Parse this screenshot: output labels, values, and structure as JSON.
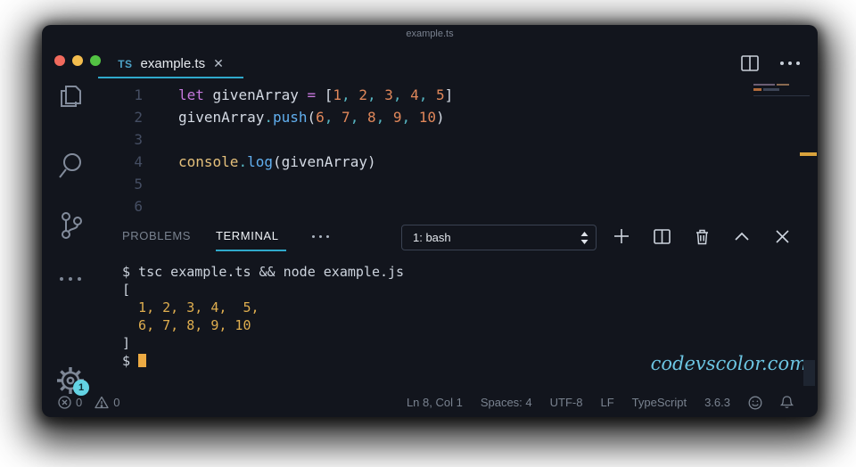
{
  "window": {
    "title": "example.ts"
  },
  "colors": {
    "accent_cyan": "#2fa9cb",
    "badge_cyan": "#63d3e4",
    "ruler_mark_orange": "#d9a33c",
    "terminal_yellow": "#dfae4f",
    "keyword_purple": "#c678dd",
    "number_orange": "#e0875a",
    "function_blue": "#61afef",
    "object_yellow": "#e5c07b"
  },
  "activity_bar": {
    "settings_badge": "1"
  },
  "tab_bar": {
    "tab_icon": "TS",
    "tab_label": "example.ts",
    "close_glyph": "✕"
  },
  "editor": {
    "lines": [
      {
        "num": "1",
        "tokens": [
          [
            "kw",
            "let"
          ],
          [
            "fg",
            " givenArray "
          ],
          [
            "kw",
            "="
          ],
          [
            "fg",
            " ["
          ],
          [
            "num",
            "1"
          ],
          [
            "comma",
            ", "
          ],
          [
            "num",
            "2"
          ],
          [
            "comma",
            ", "
          ],
          [
            "num",
            "3"
          ],
          [
            "comma",
            ", "
          ],
          [
            "num",
            "4"
          ],
          [
            "comma",
            ", "
          ],
          [
            "num",
            "5"
          ],
          [
            "fg",
            "]"
          ]
        ]
      },
      {
        "num": "2",
        "tokens": [
          [
            "fg",
            "givenArray"
          ],
          [
            "dot",
            "."
          ],
          [
            "fn",
            "push"
          ],
          [
            "fg",
            "("
          ],
          [
            "num",
            "6"
          ],
          [
            "comma",
            ", "
          ],
          [
            "num",
            "7"
          ],
          [
            "comma",
            ", "
          ],
          [
            "num",
            "8"
          ],
          [
            "comma",
            ", "
          ],
          [
            "num",
            "9"
          ],
          [
            "comma",
            ", "
          ],
          [
            "num",
            "10"
          ],
          [
            "fg",
            ")"
          ]
        ]
      },
      {
        "num": "3",
        "tokens": []
      },
      {
        "num": "4",
        "tokens": [
          [
            "obj",
            "console"
          ],
          [
            "dot",
            "."
          ],
          [
            "fn",
            "log"
          ],
          [
            "fg",
            "("
          ],
          [
            "fg",
            "givenArray"
          ],
          [
            "fg",
            ")"
          ]
        ]
      },
      {
        "num": "5",
        "tokens": []
      },
      {
        "num": "6",
        "tokens": []
      }
    ]
  },
  "panel": {
    "tab_problems": "PROBLEMS",
    "tab_terminal": "TERMINAL",
    "dropdown_value": "1: bash"
  },
  "terminal": {
    "lines": [
      {
        "cls": "fg",
        "text": "$ tsc example.ts && node example.js"
      },
      {
        "cls": "fg",
        "text": "["
      },
      {
        "cls": "yellow",
        "text": "  1, 2, 3, 4,  5,"
      },
      {
        "cls": "yellow",
        "text": "  6, 7, 8, 9, 10"
      },
      {
        "cls": "fg",
        "text": "]"
      },
      {
        "cls": "fg",
        "text": "$ ",
        "cursor": true
      }
    ],
    "watermark": "codevscolor.com"
  },
  "status_bar": {
    "errors": "0",
    "warnings": "0",
    "items": [
      "Ln 8, Col 1",
      "Spaces: 4",
      "UTF-8",
      "LF",
      "TypeScript",
      "3.6.3"
    ]
  }
}
